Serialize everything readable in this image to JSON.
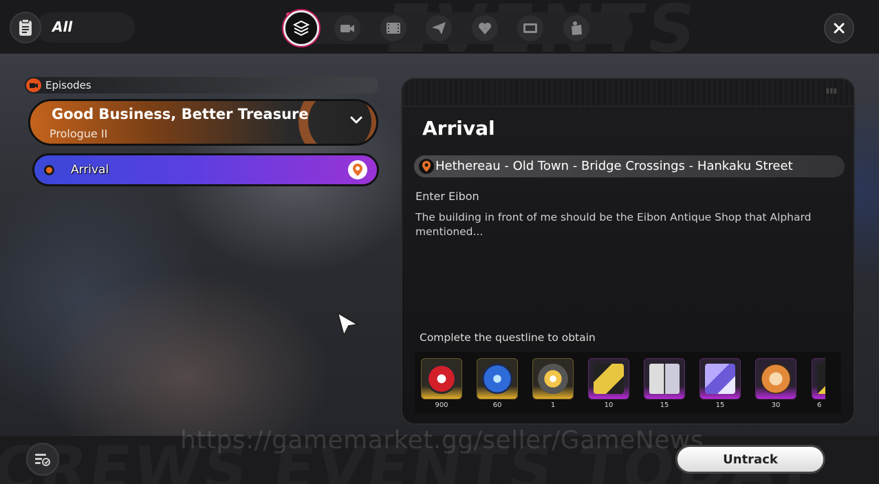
{
  "header": {
    "filter_label": "All",
    "tabs": [
      {
        "icon": "layers-icon",
        "active": true
      },
      {
        "icon": "camera-icon",
        "active": false
      },
      {
        "icon": "film-icon",
        "active": false
      },
      {
        "icon": "paper-plane-icon",
        "active": false
      },
      {
        "icon": "flower-icon",
        "active": false
      },
      {
        "icon": "tv-icon",
        "active": false
      },
      {
        "icon": "bag-icon",
        "active": false
      }
    ]
  },
  "sidebar": {
    "section_label": "Episodes",
    "quest": {
      "title": "Good Business, Better Treasure",
      "subtitle": "Prologue II"
    },
    "objective_item": {
      "label": "Arrival"
    }
  },
  "detail": {
    "title": "Arrival",
    "location": "Hethereau - Old Town - Bridge Crossings - Hankaku Street",
    "objective_title": "Enter Eibon",
    "objective_desc": "The building in front of me should be the Eibon Antique Shop that Alphard mentioned...",
    "rewards_label": "Complete the questline to obtain",
    "rewards": [
      {
        "icon": "polychrome-icon",
        "qty": "900",
        "rarity": "gold"
      },
      {
        "icon": "master-tape-icon",
        "qty": "60",
        "rarity": "gold"
      },
      {
        "icon": "burst-icon",
        "qty": "1",
        "rarity": "gold"
      },
      {
        "icon": "card-pack-icon",
        "qty": "10",
        "rarity": "purple"
      },
      {
        "icon": "trading-cards-icon",
        "qty": "15",
        "rarity": "purple"
      },
      {
        "icon": "crystal-icon",
        "qty": "15",
        "rarity": "purple"
      },
      {
        "icon": "bangboo-coin-icon",
        "qty": "30",
        "rarity": "purple"
      },
      {
        "icon": "item-icon",
        "qty": "6",
        "rarity": "purple"
      }
    ]
  },
  "footer": {
    "untrack_label": "Untrack"
  },
  "watermark": "https://gamemarket.gg/seller/GameNews",
  "colors": {
    "accent_orange": "#e2511a",
    "objective_gradient_start": "#3a48d8",
    "objective_gradient_end": "#9b33d6",
    "reward_gold": "#e3ad2a",
    "reward_purple": "#b52bd6"
  }
}
